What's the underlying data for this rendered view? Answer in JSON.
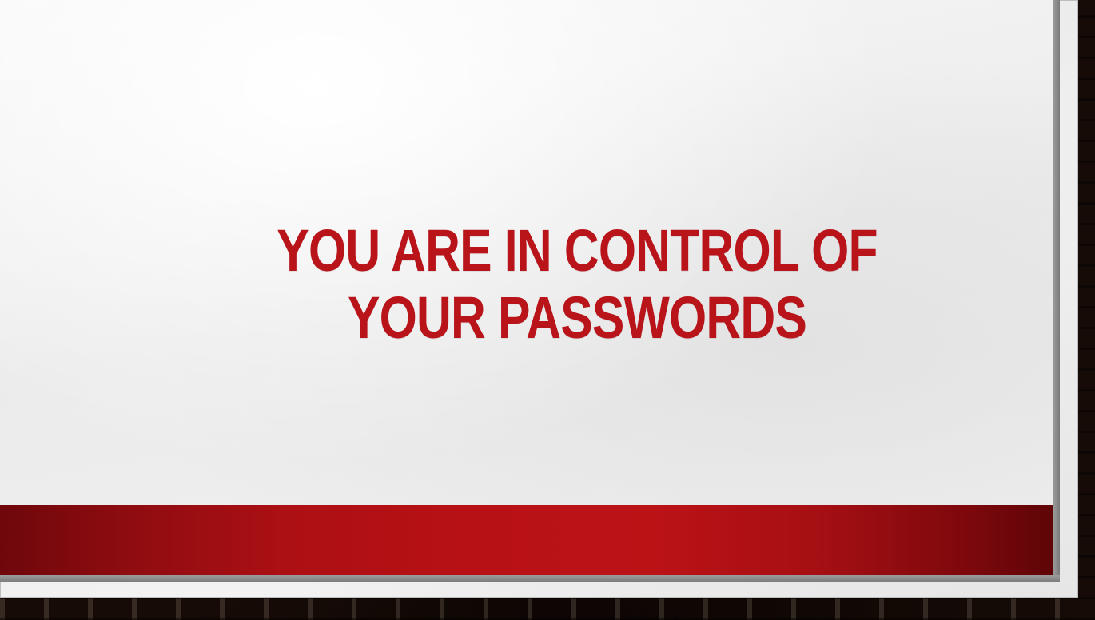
{
  "slide": {
    "title": "YOU ARE IN CONTROL OF YOUR PASSWORDS"
  },
  "colors": {
    "title": "#b8141a",
    "band_center": "#bb1216",
    "band_edge": "#5e0508",
    "paper": "#efefef"
  }
}
